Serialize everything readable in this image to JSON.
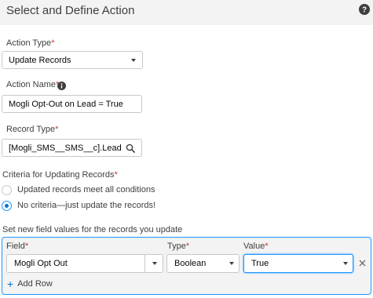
{
  "header": {
    "title": "Select and Define Action",
    "help_icon": "help-icon"
  },
  "action_type": {
    "label": "Action Type",
    "required": "*",
    "value": "Update Records"
  },
  "action_name": {
    "label": "Action Name",
    "required": "*",
    "value": "Mogli Opt-Out on Lead = True",
    "info_icon": "info-icon"
  },
  "record_type": {
    "label": "Record Type",
    "required": "*",
    "value": "[Mogli_SMS__SMS__c].Lead",
    "search_icon": "search-icon"
  },
  "criteria": {
    "label": "Criteria for Updating Records",
    "required": "*",
    "options": [
      {
        "label": "Updated records meet all conditions",
        "checked": false
      },
      {
        "label": "No criteria—just update the records!",
        "checked": true
      }
    ]
  },
  "field_values": {
    "label": "Set new field values for the records you update",
    "columns": {
      "field": "Field",
      "type": "Type",
      "value": "Value",
      "required": "*"
    },
    "rows": [
      {
        "field": "Mogli Opt Out",
        "type": "Boolean",
        "value": "True"
      }
    ],
    "add_row_label": "Add Row"
  },
  "colors": {
    "accent": "#0176d3",
    "required": "#c23934",
    "focus_border": "#1b96ff"
  }
}
